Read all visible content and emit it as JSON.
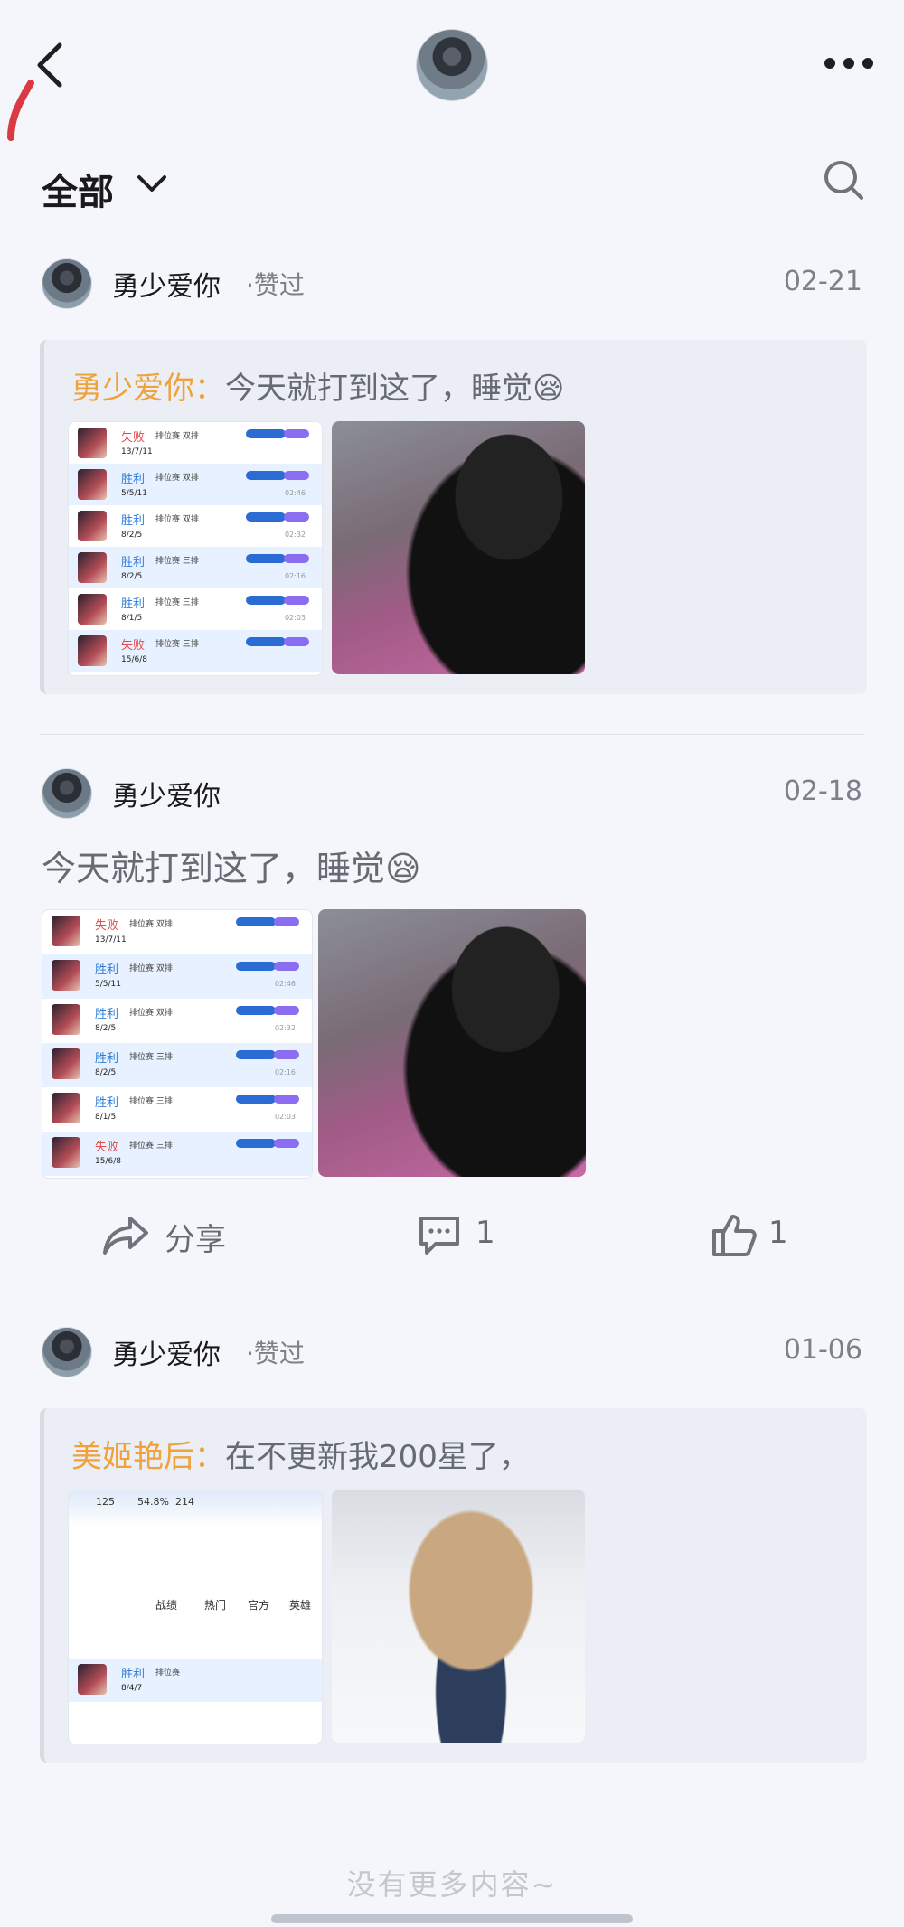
{
  "filter": {
    "label": "全部"
  },
  "posts": [
    {
      "author": "勇少爱你",
      "liked": "·赞过",
      "date": "02-21",
      "quote": {
        "name": "勇少爱你：",
        "text": "今天就打到这了，睡觉😪"
      }
    },
    {
      "author": "勇少爱你",
      "date": "02-18",
      "text": "今天就打到这了，睡觉😪",
      "actions": {
        "share": "分享",
        "comments": "1",
        "likes": "1"
      }
    },
    {
      "author": "勇少爱你",
      "liked": "·赞过",
      "date": "01-06",
      "quote": {
        "name": "美姬艳后：",
        "text": "在不更新我200星了，"
      }
    }
  ],
  "match_list": [
    {
      "result": "失败",
      "mode": "排位赛 双排",
      "kda": "13/7/11"
    },
    {
      "result": "胜利",
      "mode": "排位赛 双排",
      "kda": "5/5/11",
      "time": "02:46"
    },
    {
      "result": "胜利",
      "mode": "排位赛 双排",
      "kda": "8/2/5",
      "time": "02:32"
    },
    {
      "result": "胜利",
      "mode": "排位赛 三排",
      "kda": "8/2/5",
      "time": "02:16"
    },
    {
      "result": "胜利",
      "mode": "排位赛 三排",
      "kda": "8/1/5",
      "time": "02:03"
    },
    {
      "result": "失败",
      "mode": "排位赛 三排",
      "kda": "15/6/8"
    }
  ],
  "profile_shot": {
    "stats": [
      "125",
      "54.8%",
      "214"
    ],
    "tabs": [
      "战绩",
      "热门",
      "官方",
      "英雄"
    ],
    "row_result": "胜利",
    "row_mode": "排位赛",
    "row_kda": "8/4/7"
  },
  "footer": {
    "no_more": "没有更多内容~"
  }
}
